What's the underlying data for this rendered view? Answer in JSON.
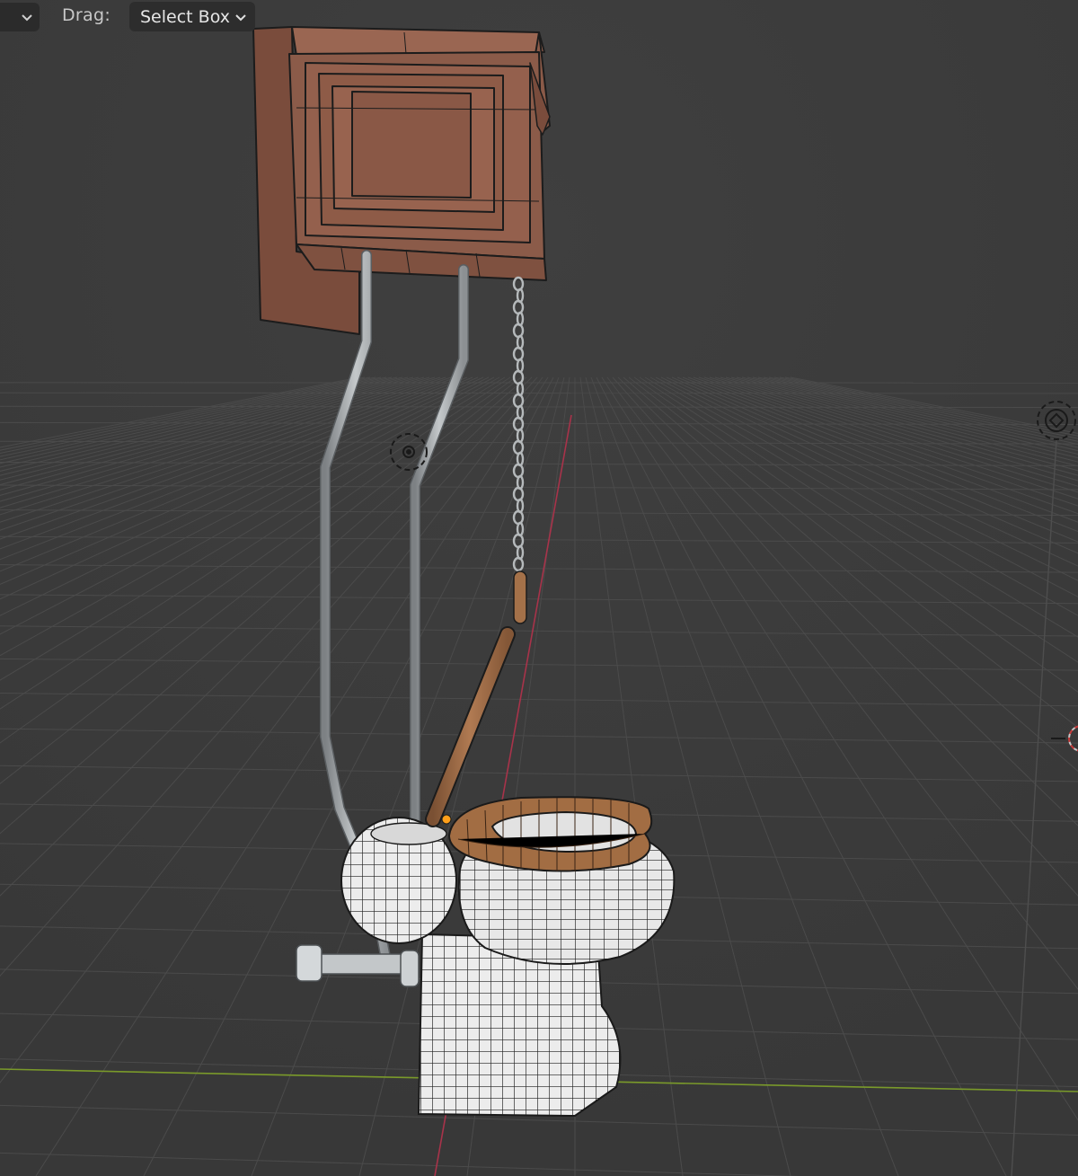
{
  "toolbar": {
    "mode_dropdown_icon": "chevron-down-icon",
    "drag_label": "Drag:",
    "select_mode": "Select Box",
    "select_mode_icon": "chevron-down-icon"
  },
  "viewport": {
    "background": "#3c3c3c",
    "grid_color": "#4a4a4a",
    "x_axis_color": "#7a9a2a",
    "y_axis_color": "#a8334a",
    "tank_color": "#8a5a48",
    "seat_color": "#8e5e3e",
    "porcelain_color": "#e6e6e6",
    "pipe_color": "#b8bcbe",
    "objects": [
      "toilet-tank",
      "flush-pipe-left",
      "flush-pipe-right",
      "pull-chain",
      "toilet-bowl",
      "toilet-seat",
      "toilet-lid",
      "floor-pipe",
      "light-object-icon",
      "camera-object-icon",
      "3d-cursor-icon"
    ]
  }
}
